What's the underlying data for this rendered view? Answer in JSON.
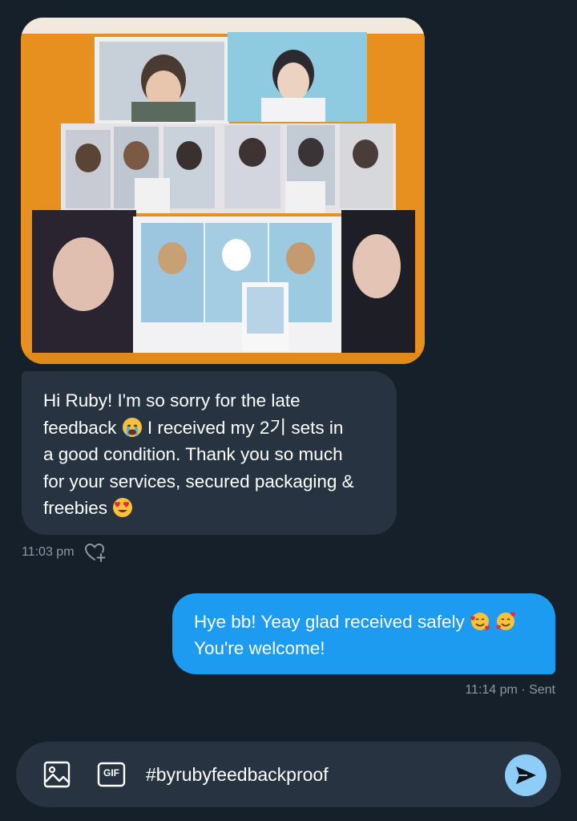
{
  "conversation": {
    "received_message": {
      "line1": "Hi Ruby! I'm so sorry for the late",
      "line2_a": "feedback",
      "emoji1": "loudly-crying-face",
      "line2_b": "I received my 2기 sets in",
      "line3": "a good condition. Thank you so much",
      "line4": "for your services, secured packaging &",
      "line5": "freebies",
      "emoji2": "heart-eyes-face",
      "time": "11:03 pm",
      "react_icon": "heart-plus-icon"
    },
    "sent_message": {
      "line1": "Hye bb! Yeay glad received safely",
      "emoji": "smiling-face-with-hearts",
      "line2": "You're welcome!",
      "time": "11:14 pm · Sent"
    }
  },
  "composer": {
    "text": "#byrubyfeedbackproof",
    "media_icon": "image-icon",
    "gif_label": "GIF",
    "send_icon": "send-icon"
  },
  "colors": {
    "background": "#15202b",
    "received_bubble": "#273340",
    "sent_bubble": "#1d9bf0",
    "meta_text": "#8b98a5",
    "send_button": "#8ecdf8"
  }
}
